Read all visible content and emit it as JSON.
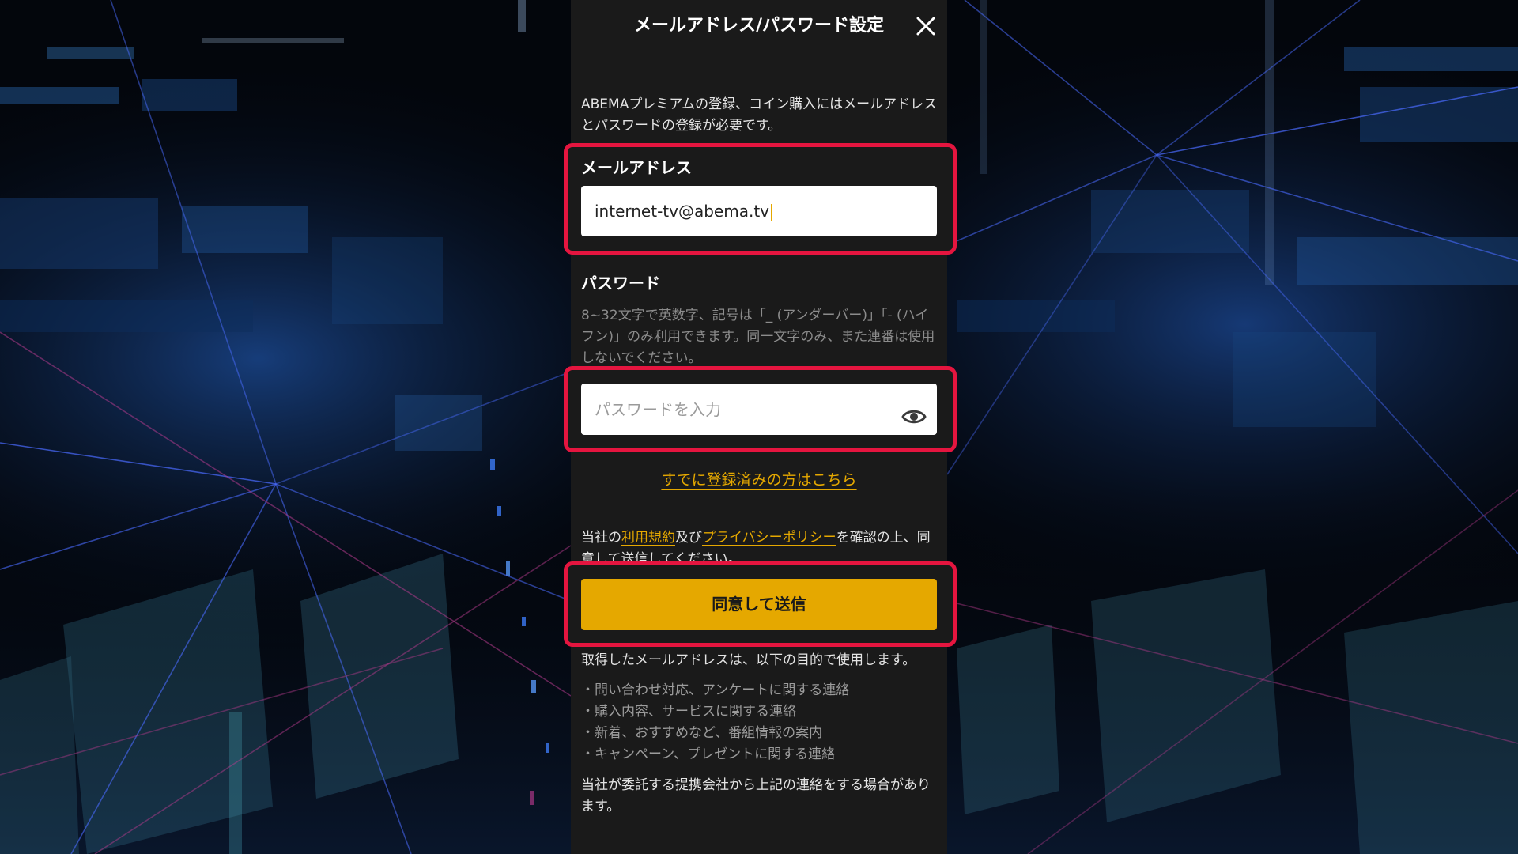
{
  "dialog": {
    "title": "メールアドレス/パスワード設定",
    "close_icon": "close-icon",
    "description": "ABEMAプレミアムの登録、コイン購入にはメールアドレスとパスワードの登録が必要です。"
  },
  "email": {
    "label": "メールアドレス",
    "value": "internet-tv@abema.tv"
  },
  "password": {
    "label": "パスワード",
    "hint": "8~32文字で英数字、記号は「_ (アンダーバー)」「- (ハイフン)」のみ利用できます。同一文字のみ、また連番は使用しないでください。",
    "placeholder": "パスワードを入力",
    "toggle_icon": "eye-icon"
  },
  "login_link": "すでに登録済みの方はこちら",
  "terms": {
    "prefix": "当社の",
    "terms_link": "利用規約",
    "conjunction": "及び",
    "privacy_link": "プライバシーポリシー",
    "suffix": "を確認の上、同意して送信してください。"
  },
  "submit_label": "同意して送信",
  "usage": {
    "intro": "取得したメールアドレスは、以下の目的で使用します。",
    "items": [
      "・問い合わせ対応、アンケートに関する連絡",
      "・購入内容、サービスに関する連絡",
      "・新着、おすすめなど、番組情報の案内",
      "・キャンペーン、プレゼントに関する連絡"
    ],
    "note": "当社が委託する提携会社から上記の連絡をする場合があります。"
  },
  "theme": {
    "accent": "#e5a800",
    "highlight": "#e5153f",
    "panel": "#1a1a1a"
  }
}
